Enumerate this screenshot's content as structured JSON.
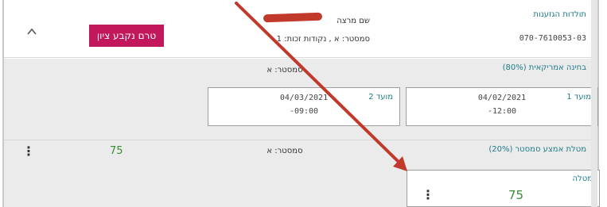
{
  "header": {
    "status_badge": "טרם נקבע ציון",
    "student_name": "שם מרצה",
    "student_meta": "סמסטר: א , נקודות זכות: 1",
    "dept_link": "תולדות הגזענות",
    "student_id": "070-7610053-03"
  },
  "exam_section": {
    "title": "בחינה אמריקאית (80%)",
    "semester": "סמסטר: א",
    "moeds": [
      {
        "label": "מועד 1",
        "date": "04/02/2021",
        "time": "-12:00"
      },
      {
        "label": "מועד 2",
        "date": "04/03/2021",
        "time": "-09:00"
      }
    ]
  },
  "task_section": {
    "title": "מטלת אמצע סמסטר (20%)",
    "semester": "סמסטר: א",
    "grade": "75",
    "task_card": {
      "label": "מטלה",
      "grade": "75"
    }
  },
  "colors": {
    "accent_teal": "#1e7a88",
    "badge_magenta": "#c2185b",
    "grade_green": "#3a8a3a",
    "annotation_red": "#c0392b"
  },
  "icons": {
    "collapse": "chevron-up-icon",
    "menu": "kebab-menu-icon"
  }
}
